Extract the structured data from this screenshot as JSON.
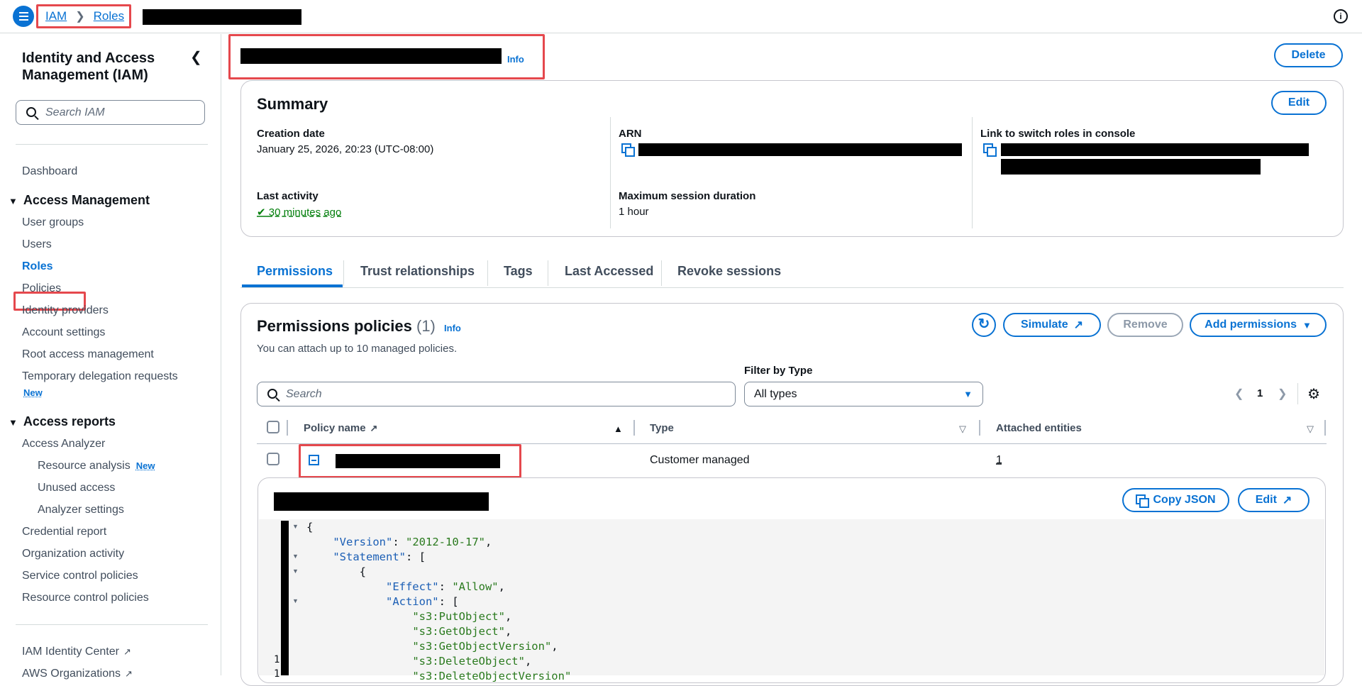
{
  "topbar": {
    "breadcrumb_root": "IAM",
    "breadcrumb_current": "Roles"
  },
  "sidebar": {
    "title": "Identity and Access Management (IAM)",
    "search_placeholder": "Search IAM",
    "dashboard": "Dashboard",
    "access_management": {
      "heading": "Access Management",
      "items": [
        "User groups",
        "Users",
        "Roles",
        "Policies",
        "Identity providers",
        "Account settings",
        "Root access management",
        "Temporary delegation requests"
      ],
      "new_badge": "New"
    },
    "access_reports": {
      "heading": "Access reports",
      "analyzer": "Access Analyzer",
      "sub_items": [
        "Resource analysis",
        "Unused access",
        "Analyzer settings"
      ],
      "resource_new_badge": "New",
      "items": [
        "Credential report",
        "Organization activity",
        "Service control policies",
        "Resource control policies"
      ]
    },
    "bottom": [
      "IAM Identity Center",
      "AWS Organizations"
    ]
  },
  "header": {
    "info": "Info",
    "delete": "Delete"
  },
  "summary": {
    "title": "Summary",
    "edit": "Edit",
    "creation_date_label": "Creation date",
    "creation_date": "January 25, 2026, 20:23 (UTC-08:00)",
    "arn_label": "ARN",
    "link_label": "Link to switch roles in console",
    "last_activity_label": "Last activity",
    "last_activity": "30 minutes ago",
    "max_session_label": "Maximum session duration",
    "max_session": "1 hour"
  },
  "tabs": [
    "Permissions",
    "Trust relationships",
    "Tags",
    "Last Accessed",
    "Revoke sessions"
  ],
  "policies": {
    "title": "Permissions policies",
    "count": "(1)",
    "info": "Info",
    "description": "You can attach up to 10 managed policies.",
    "simulate": "Simulate",
    "remove": "Remove",
    "add_permissions": "Add permissions",
    "filter_label": "Filter by Type",
    "search_placeholder": "Search",
    "filter_value": "All types",
    "page": "1",
    "columns": [
      "Policy name",
      "Type",
      "Attached entities"
    ],
    "row": {
      "type": "Customer managed",
      "attached": "1"
    },
    "copy_json": "Copy JSON",
    "edit": "Edit"
  },
  "code": {
    "lines": [
      "{",
      "    \"Version\": \"2012-10-17\",",
      "    \"Statement\": [",
      "        {",
      "            \"Effect\": \"Allow\",",
      "            \"Action\": [",
      "                \"s3:PutObject\",",
      "                \"s3:GetObject\",",
      "                \"s3:GetObjectVersion\",",
      "                \"s3:DeleteObject\",",
      "                \"s3:DeleteObjectVersion\""
    ],
    "gutter_numbers": [
      "1",
      "1"
    ]
  }
}
